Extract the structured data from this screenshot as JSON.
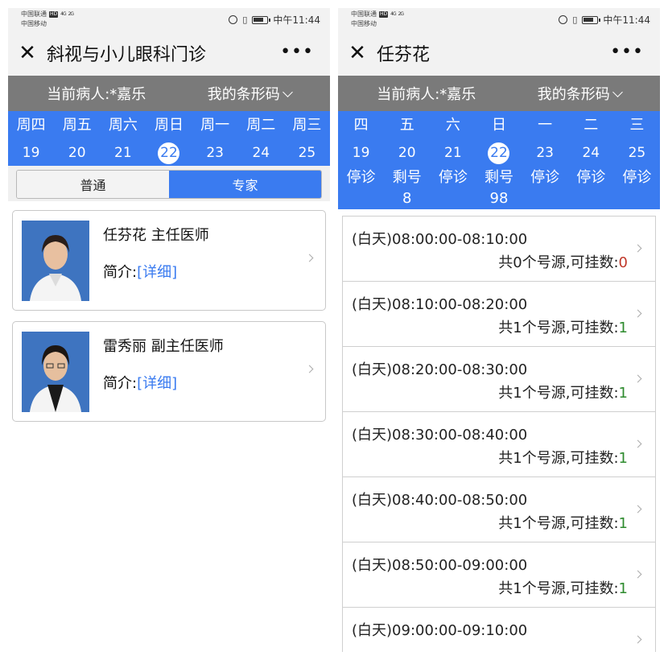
{
  "status": {
    "carrier1": "中国联通",
    "carrier2": "中国移动",
    "hd": "HD",
    "signal1": "4G",
    "signal2": "2G",
    "time": "中午11:44"
  },
  "left": {
    "title": "斜视与小儿眼科门诊",
    "patient": "当前病人:*嘉乐",
    "barcode": "我的条形码",
    "weekdays": [
      "周四",
      "周五",
      "周六",
      "周日",
      "周一",
      "周二",
      "周三"
    ],
    "dates": [
      "19",
      "20",
      "21",
      "22",
      "23",
      "24",
      "25"
    ],
    "selected_date": "22",
    "tabs": {
      "normal": "普通",
      "expert": "专家"
    },
    "doctors": [
      {
        "name": "任芬花 主任医师",
        "intro_label": "简介:",
        "intro_link": "[详细]"
      },
      {
        "name": "雷秀丽 副主任医师",
        "intro_label": "简介:",
        "intro_link": "[详细]"
      }
    ]
  },
  "right": {
    "title": "任芬花",
    "patient": "当前病人:*嘉乐",
    "barcode": "我的条形码",
    "weekdays": [
      "四",
      "五",
      "六",
      "日",
      "一",
      "二",
      "三"
    ],
    "dates": [
      "19",
      "20",
      "21",
      "22",
      "23",
      "24",
      "25"
    ],
    "selected_date": "22",
    "status_labels": [
      "停诊",
      "剩号",
      "停诊",
      "剩号",
      "停诊",
      "停诊",
      "停诊"
    ],
    "status_counts": [
      "",
      "8",
      "",
      "98",
      "",
      "",
      ""
    ],
    "slots": [
      {
        "time": "(白天)08:00:00-08:10:00",
        "info": "共0个号源,可挂数:",
        "count": "0"
      },
      {
        "time": "(白天)08:10:00-08:20:00",
        "info": "共1个号源,可挂数:",
        "count": "1"
      },
      {
        "time": "(白天)08:20:00-08:30:00",
        "info": "共1个号源,可挂数:",
        "count": "1"
      },
      {
        "time": "(白天)08:30:00-08:40:00",
        "info": "共1个号源,可挂数:",
        "count": "1"
      },
      {
        "time": "(白天)08:40:00-08:50:00",
        "info": "共1个号源,可挂数:",
        "count": "1"
      },
      {
        "time": "(白天)08:50:00-09:00:00",
        "info": "共1个号源,可挂数:",
        "count": "1"
      },
      {
        "time": "(白天)09:00:00-09:10:00",
        "info": "",
        "count": ""
      }
    ]
  },
  "colors": {
    "accent": "#3a7bf0",
    "patient_bar": "#7a7a7a",
    "count_zero": "#c0392b",
    "count_ok": "#2e8b2e"
  }
}
